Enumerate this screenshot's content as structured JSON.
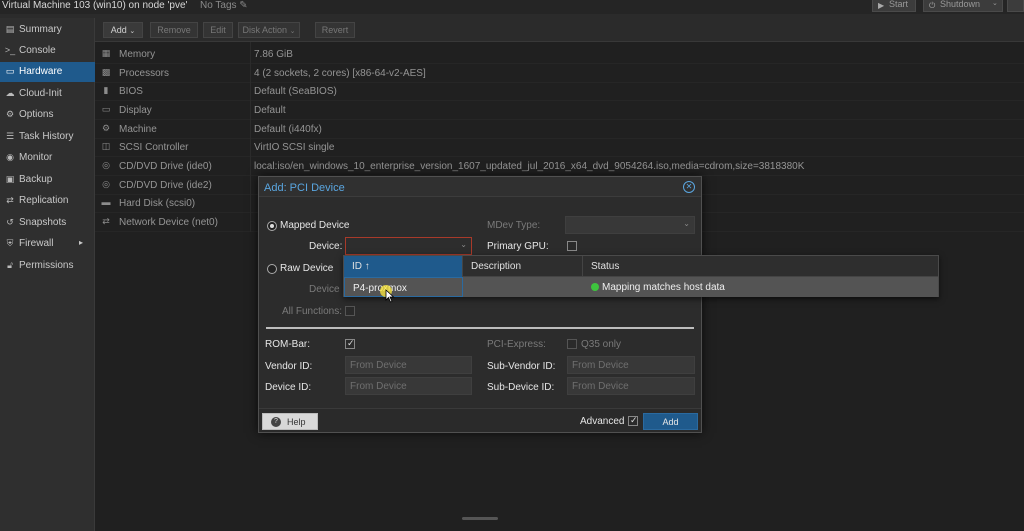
{
  "header": {
    "vm_title": "Virtual Machine 103 (win10) on node 'pve'",
    "tags": "No Tags",
    "tags_icon": "pencil-icon",
    "start_label": "Start",
    "shutdown_label": "Shutdown"
  },
  "sidebar": {
    "items": [
      {
        "label": "Summary",
        "icon": "summary-icon"
      },
      {
        "label": "Console",
        "icon": "console-icon"
      },
      {
        "label": "Hardware",
        "icon": "hardware-icon",
        "active": true
      },
      {
        "label": "Cloud-Init",
        "icon": "cloud-icon"
      },
      {
        "label": "Options",
        "icon": "gear-icon"
      },
      {
        "label": "Task History",
        "icon": "list-icon"
      },
      {
        "label": "Monitor",
        "icon": "eye-icon"
      },
      {
        "label": "Backup",
        "icon": "backup-icon"
      },
      {
        "label": "Replication",
        "icon": "replication-icon"
      },
      {
        "label": "Snapshots",
        "icon": "history-icon"
      },
      {
        "label": "Firewall",
        "icon": "shield-icon"
      },
      {
        "label": "Permissions",
        "icon": "unlock-icon"
      }
    ]
  },
  "toolbar": {
    "add": "Add",
    "remove": "Remove",
    "edit": "Edit",
    "disk_action": "Disk Action",
    "revert": "Revert"
  },
  "hardware": [
    {
      "name": "Memory",
      "value": "7.86 GiB",
      "icon": "memory-icon"
    },
    {
      "name": "Processors",
      "value": "4 (2 sockets, 2 cores) [x86-64-v2-AES]",
      "icon": "cpu-icon"
    },
    {
      "name": "BIOS",
      "value": "Default (SeaBIOS)",
      "icon": "bios-icon"
    },
    {
      "name": "Display",
      "value": "Default",
      "icon": "monitor-icon"
    },
    {
      "name": "Machine",
      "value": "Default (i440fx)",
      "icon": "cogs-icon"
    },
    {
      "name": "SCSI Controller",
      "value": "VirtIO SCSI single",
      "icon": "database-icon"
    },
    {
      "name": "CD/DVD Drive (ide0)",
      "value": "local:iso/en_windows_10_enterprise_version_1607_updated_jul_2016_x64_dvd_9054264.iso,media=cdrom,size=3818380K",
      "icon": "disc-icon"
    },
    {
      "name": "CD/DVD Drive (ide2)",
      "value": "",
      "icon": "disc-icon"
    },
    {
      "name": "Hard Disk (scsi0)",
      "value": "",
      "icon": "hdd-icon"
    },
    {
      "name": "Network Device (net0)",
      "value": "",
      "icon": "exchange-icon"
    }
  ],
  "dialog": {
    "title": "Add: PCI Device",
    "mapped_device": "Mapped Device",
    "raw_device": "Raw Device",
    "device": "Device:",
    "device_raw": "Device",
    "all_functions": "All Functions:",
    "mdev_type": "MDev Type:",
    "primary_gpu": "Primary GPU:",
    "rom_bar": "ROM-Bar:",
    "pci_express": "PCI-Express:",
    "q35_only": "Q35 only",
    "vendor_id": "Vendor ID:",
    "device_id": "Device ID:",
    "sub_vendor_id": "Sub-Vendor ID:",
    "sub_device_id": "Sub-Device ID:",
    "from_device": "From Device",
    "help": "Help",
    "advanced": "Advanced",
    "add": "Add"
  },
  "dropdown": {
    "columns": [
      "ID ↑",
      "Description",
      "Status"
    ],
    "rows": [
      {
        "id": "P4-proxmox",
        "description": "",
        "status": "Mapping matches host data"
      }
    ]
  }
}
